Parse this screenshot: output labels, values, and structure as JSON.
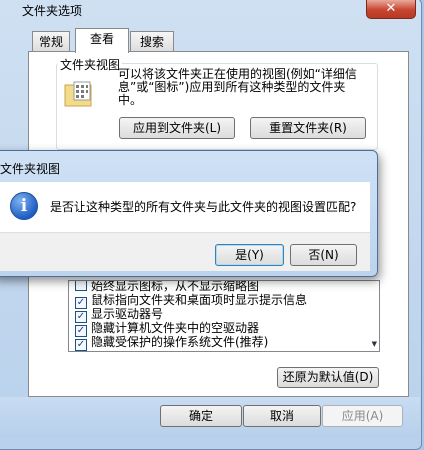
{
  "window": {
    "title": "文件夹选项",
    "close_glyph": "✕"
  },
  "tabs": [
    "常规",
    "查看",
    "搜索"
  ],
  "folder_views": {
    "group_label": "文件夹视图",
    "description_lines": [
      "可以将该文件夹正在使用的视图(例如“详细信",
      "息”或“图标”)应用到所有这种类型的文件夹",
      "中。"
    ],
    "apply_button": "应用到文件夹(L)",
    "reset_button": "重置文件夹(R)"
  },
  "advanced_list": {
    "items": [
      {
        "label": "始终显示图标，从不显示缩略图",
        "checked": false
      },
      {
        "label": "鼠标指向文件夹和桌面项时显示提示信息",
        "checked": true
      },
      {
        "label": "显示驱动器号",
        "checked": true
      },
      {
        "label": "隐藏计算机文件夹中的空驱动器",
        "checked": true
      },
      {
        "label": "隐藏受保护的操作系统文件(推荐)",
        "checked": true
      }
    ]
  },
  "restore_defaults_button": "还原为默认值(D)",
  "footer": {
    "ok": "确定",
    "cancel": "取消",
    "apply": "应用(A)"
  },
  "dialog": {
    "title": "文件夹视图",
    "message": "是否让这种类型的所有文件夹与此文件夹的视图设置匹配?",
    "icon_glyph": "i",
    "yes": "是(Y)",
    "no": "否(N)"
  },
  "colors": {
    "window_frame": "#b9d1ec",
    "close_button": "#c9452f",
    "focus_border": "#3c7fb1"
  }
}
